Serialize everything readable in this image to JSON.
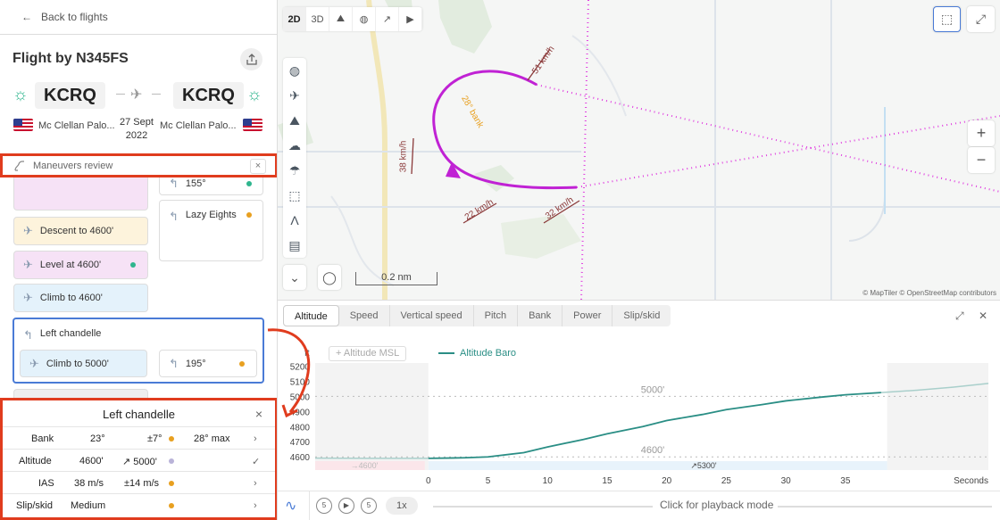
{
  "nav": {
    "back_label": "Back to flights"
  },
  "flight": {
    "title": "Flight by N345FS",
    "from_code": "KCRQ",
    "to_code": "KCRQ",
    "from_name": "Mc Clellan Palo...",
    "to_name": "Mc Clellan Palo...",
    "date_day": "27 Sept",
    "date_year": "2022"
  },
  "maneuvers": {
    "bar_label": "Maneuvers review",
    "close": "×",
    "cards": [
      {
        "label": "155°",
        "color": "#ffffff",
        "dot": "#2fb58e"
      },
      {
        "label": "Lazy Eights",
        "color": "#ffffff",
        "dot": "#e8a020"
      },
      {
        "label": "Descent to 4600'",
        "color": "#fdf3dc",
        "dot": ""
      },
      {
        "label": "Level at 4600'",
        "color": "#f6e2f6",
        "dot": "#2fb58e"
      },
      {
        "label": "Climb to 4600'",
        "color": "#e4f2fb",
        "dot": ""
      },
      {
        "label": "Left chandelle",
        "color": "#ffffff",
        "dot": ""
      },
      {
        "label": "Climb to 5000'",
        "color": "#e4f2fb",
        "dot": ""
      },
      {
        "label": "195°",
        "color": "#ffffff",
        "dot": "#e8a020"
      }
    ]
  },
  "detail": {
    "title": "Left chandelle",
    "close": "×",
    "rows": [
      {
        "name": "Bank",
        "value": "23°",
        "tolerance": "±7°",
        "extra": "28° max",
        "dot": "#e8a020",
        "action": "›"
      },
      {
        "name": "Altitude",
        "value": "4600'",
        "tolerance": "↗ 5000'",
        "extra": "",
        "dot": "#b9b3d8",
        "action": "✓"
      },
      {
        "name": "IAS",
        "value": "38 m/s",
        "tolerance": "±14 m/s",
        "extra": "",
        "dot": "#e8a020",
        "action": "›"
      },
      {
        "name": "Slip/skid",
        "value": "Medium",
        "tolerance": "",
        "extra": "",
        "dot": "#e8a020",
        "action": "›"
      }
    ]
  },
  "map": {
    "view_buttons": [
      "2D",
      "3D"
    ],
    "scale_label": "0.2 nm",
    "attribution": "© MapTiler © OpenStreetMap contributors",
    "annotations": {
      "bank": "28° bank",
      "wind1": "51 km/h",
      "wind2": "38 km/h",
      "wind3": "22 km/h",
      "wind4": "32 km/h"
    },
    "zoom_in": "+",
    "zoom_out": "−"
  },
  "chart_panel": {
    "tabs": [
      "Altitude",
      "Speed",
      "Vertical speed",
      "Pitch",
      "Bank",
      "Power",
      "Slip/skid"
    ],
    "active_tab": "Altitude",
    "legend_msl": "+ Altitude MSL",
    "legend_baro": "Altitude Baro",
    "playback": {
      "back_label": "5",
      "fwd_label": "5",
      "speed": "1x",
      "hint": "Click for playback mode"
    }
  },
  "chart_data": {
    "type": "line",
    "ylabel": "ft",
    "xlabel": "Seconds",
    "y_ticks": [
      4600,
      4700,
      4800,
      4900,
      5000,
      5100,
      5200
    ],
    "x_ticks": [
      0,
      5,
      10,
      15,
      20,
      25,
      30,
      35
    ],
    "ylim": [
      4560,
      5220
    ],
    "xlim": [
      -9.5,
      47
    ],
    "grid": false,
    "reference_lines": [
      {
        "label": "5000'",
        "value": 5000
      },
      {
        "label": "4600'",
        "value": 4600
      }
    ],
    "bottom_labels": [
      "→4600'",
      "↗5300'"
    ],
    "series": [
      {
        "name": "Altitude Baro",
        "color": "#2a8e85",
        "x": [
          -9.5,
          -5,
          0,
          3,
          5,
          8,
          10,
          13,
          15,
          18,
          20,
          23,
          25,
          28,
          30,
          33,
          35,
          38,
          41,
          44,
          47
        ],
        "y": [
          4592,
          4590,
          4590,
          4594,
          4600,
          4628,
          4665,
          4715,
          4752,
          4800,
          4840,
          4880,
          4912,
          4945,
          4970,
          4995,
          5010,
          5025,
          5040,
          5060,
          5085
        ]
      }
    ]
  }
}
